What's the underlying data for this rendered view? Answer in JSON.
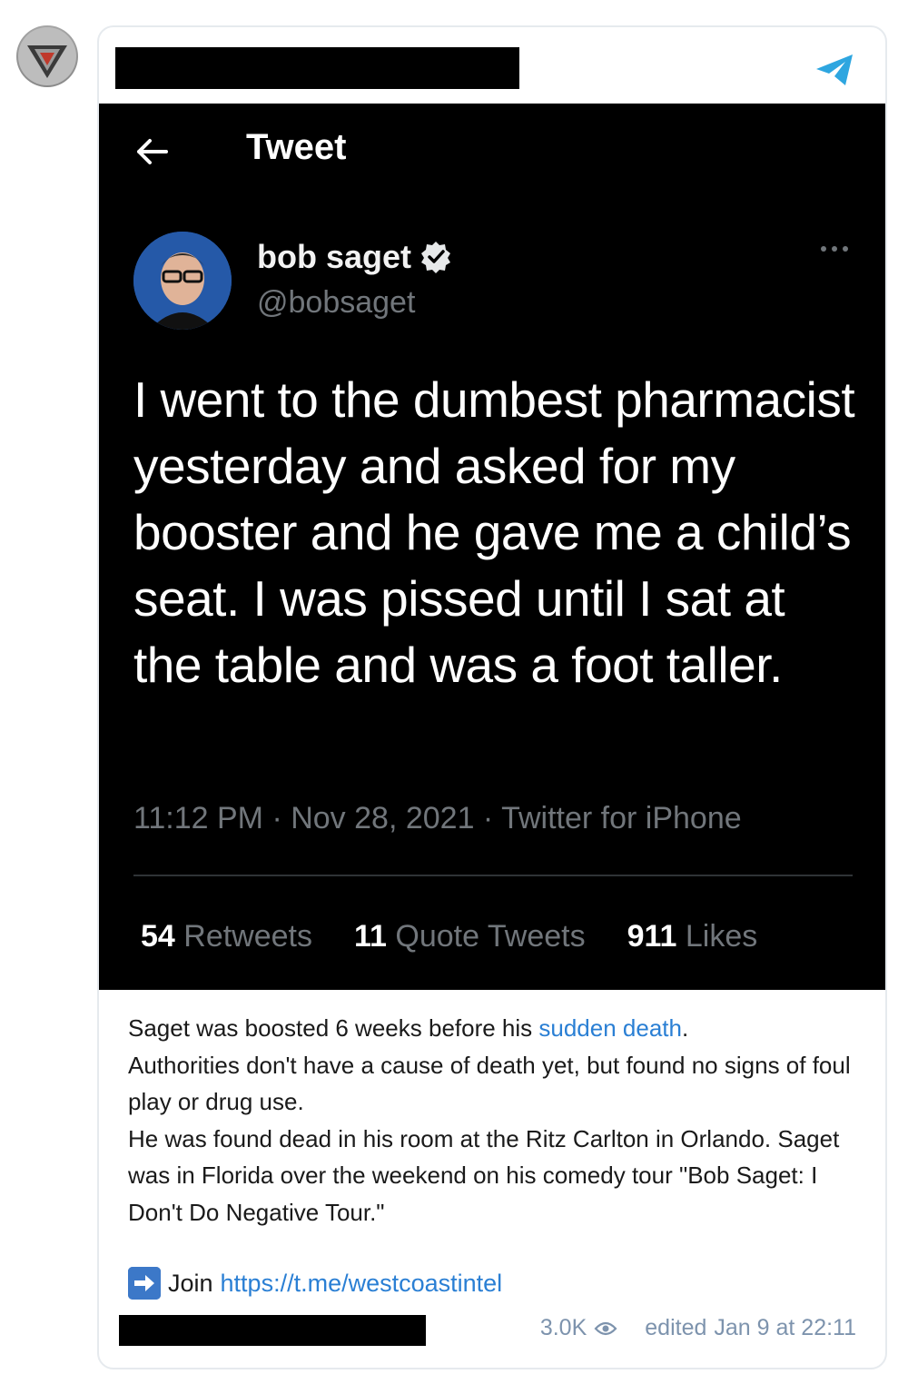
{
  "tweet": {
    "header_title": "Tweet",
    "display_name": "bob saget",
    "handle": "@bobsaget",
    "text": "I went to the dumbest pharmacist yesterday and asked for my booster and he gave me a child’s seat. I was pissed until I sat at the table and was a foot taller.",
    "meta": "11:12 PM · Nov 28, 2021 · Twitter for iPhone",
    "stats": {
      "retweets_count": "54",
      "retweets_label": " Retweets",
      "quotes_count": "11",
      "quotes_label": " Quote Tweets",
      "likes_count": "911",
      "likes_label": " Likes"
    }
  },
  "caption": {
    "line1_before": "Saget was boosted 6 weeks before his ",
    "line1_link": "sudden death",
    "line1_after": ".",
    "line2": "Authorities don't have a cause of death yet, but found no signs of foul play or drug use.",
    "line3": "He was found dead in his room at the Ritz Carlton in Orlando. Saget was in Florida over the weekend on his comedy tour \"Bob Saget: I Don't Do Negative Tour.\""
  },
  "join": {
    "label": "Join ",
    "url": "https://t.me/westcoastintel"
  },
  "footer": {
    "views": "3.0K",
    "edited": "edited",
    "timestamp": "Jan 9 at 22:11"
  },
  "colors": {
    "tweet_background": "#000000",
    "link": "#2a7fd4",
    "telegram_blue": "#2ea6e0",
    "verified_badge": "#e7e9ea",
    "muted_text": "#71767b"
  },
  "icons": [
    "channel-avatar",
    "share-icon",
    "back-arrow-icon",
    "verified-icon",
    "more-icon",
    "join-arrow-icon",
    "eye-icon"
  ]
}
